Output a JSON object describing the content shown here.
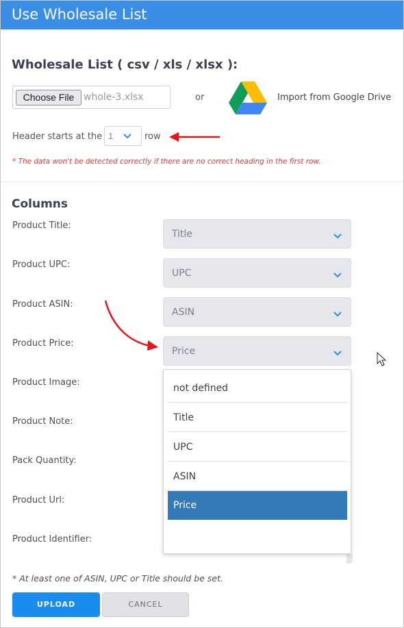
{
  "window": {
    "title": "Use Wholesale List"
  },
  "upload": {
    "heading": "Wholesale List ( csv / xls / xlsx ):",
    "choose_file_label": "Choose File",
    "file_name": "whole-3.xlsx",
    "or_text": "or",
    "gdrive_label": "Import from Google Drive",
    "header_prefix": "Header starts at the",
    "header_row_value": "1",
    "header_suffix": "row",
    "warning": "* The data won't be detected correctly if there are no correct heading in the first row."
  },
  "columns": {
    "heading": "Columns",
    "fields": [
      {
        "label": "Product Title:",
        "value": "Title"
      },
      {
        "label": "Product UPC:",
        "value": "UPC"
      },
      {
        "label": "Product ASIN:",
        "value": "ASIN"
      },
      {
        "label": "Product Price:",
        "value": "Price"
      },
      {
        "label": "Product Image:",
        "value": ""
      },
      {
        "label": "Product Note:",
        "value": ""
      },
      {
        "label": "Pack Quantity:",
        "value": ""
      },
      {
        "label": "Product Url:",
        "value": ""
      },
      {
        "label": "Product Identifier:",
        "value": ""
      }
    ],
    "open_dropdown": {
      "options": [
        "not defined",
        "Title",
        "UPC",
        "ASIN",
        "Price",
        ""
      ],
      "selected": "Price"
    }
  },
  "footer": {
    "note": "* At least one of ASIN, UPC or Title should be set.",
    "upload_label": "UPLOAD",
    "cancel_label": "CANCEL"
  },
  "colors": {
    "titlebar": "#3a8ee6",
    "primary_button": "#1a8cf0",
    "dropdown_selected": "#337ab7",
    "warning_text": "#e53935",
    "annotation_arrow": "#e8141c"
  }
}
